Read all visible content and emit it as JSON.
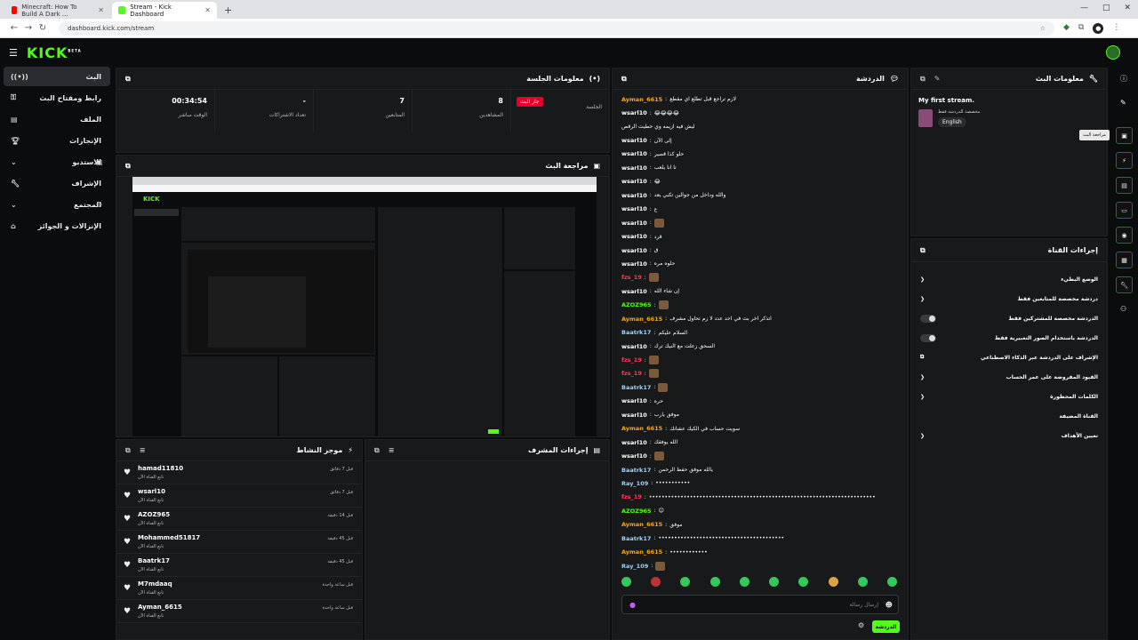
{
  "browser": {
    "tabs": [
      {
        "title": "Minecraft: How To Build A Dark ...",
        "active": false
      },
      {
        "title": "Stream - Kick Dashboard",
        "active": true
      }
    ],
    "url": "dashboard.kick.com/stream"
  },
  "brand": {
    "logo": "KICK",
    "beta": "BETA",
    "accent": "#53fc18"
  },
  "sidebar": {
    "items": [
      {
        "label": "البث",
        "icon": "live-icon",
        "active": true
      },
      {
        "label": "رابط ومفتاح البث",
        "icon": "key-icon"
      },
      {
        "label": "الملف",
        "icon": "file-icon"
      },
      {
        "label": "الإنجازات",
        "icon": "trophy-icon"
      },
      {
        "label": "الاستديو",
        "icon": "chevron-down-icon"
      },
      {
        "label": "الإشراف",
        "icon": "wrench-icon"
      },
      {
        "label": "المجتمع",
        "icon": "chevron-down-icon"
      },
      {
        "label": "الإنزالات و الجوائز",
        "icon": "gift-icon"
      }
    ]
  },
  "session": {
    "title": "معلومات الجلسة",
    "live_badge": "جار البث",
    "stats": [
      {
        "value": "00:34:54",
        "label": "الوقت مباشر"
      },
      {
        "value": "-",
        "label": "تعداد الاشتراكات"
      },
      {
        "value": "7",
        "label": "المتابعين"
      },
      {
        "value": "8",
        "label": "المشاهدين"
      },
      {
        "value": "",
        "label": "الجلسة"
      }
    ]
  },
  "preview": {
    "title": "مراجعة البث"
  },
  "activity": {
    "title": "موجز النشاط",
    "items": [
      {
        "name": "hamad11810",
        "sub": "تابع القناة الآن",
        "time": "قبل 7 دقائق"
      },
      {
        "name": "wsarl10",
        "sub": "تابع القناة الآن",
        "time": "قبل 7 دقائق"
      },
      {
        "name": "AZOZ965",
        "sub": "تابع القناة الآن",
        "time": "قبل 14 دقيقة"
      },
      {
        "name": "Mohammed51817",
        "sub": "تابع القناة الآن",
        "time": "قبل 45 دقيقة"
      },
      {
        "name": "Baatrk17",
        "sub": "تابع القناة الآن",
        "time": "قبل 45 دقيقة"
      },
      {
        "name": "M7mdaaq",
        "sub": "تابع القناة الآن",
        "time": "قبل ساعة واحدة"
      },
      {
        "name": "Ayman_6615",
        "sub": "تابع القناة الآن",
        "time": "قبل ساعة واحدة"
      }
    ]
  },
  "mod_actions": {
    "title": "إجراءات المشرف"
  },
  "chat": {
    "title": "الدردشة",
    "input_placeholder": "إرسال رسالة",
    "send_label": "الدردشة",
    "messages": [
      {
        "user": "Ayman_6615",
        "color": "#f5a623",
        "text": "لازم تراجع قبل تطلع اي مقطع"
      },
      {
        "user": "wsarl10",
        "color": "#ffffff",
        "text": "😂😂😂😂"
      },
      {
        "user": "",
        "color": "#ffffff",
        "text": "ليش فيه ازيمه وي حطيت الرقص"
      },
      {
        "user": "wsarl10",
        "color": "#ffffff",
        "text": "إلى الآن"
      },
      {
        "user": "wsarl10",
        "color": "#ffffff",
        "text": "حلو كذا قصير"
      },
      {
        "user": "wsarl10",
        "color": "#ffffff",
        "text": "تا انا يلعب"
      },
      {
        "user": "wsarl10",
        "color": "#ffffff",
        "text": "😂"
      },
      {
        "user": "wsarl10",
        "color": "#ffffff",
        "text": "والله وداخل من حوالين تكبي يعد"
      },
      {
        "user": "wsarl10",
        "color": "#ffffff",
        "text": "ع"
      },
      {
        "user": "wsarl10",
        "color": "#ffffff",
        "text": "[emote]"
      },
      {
        "user": "wsarl10",
        "color": "#ffffff",
        "text": "قرد"
      },
      {
        "user": "wsarl10",
        "color": "#ffffff",
        "text": "ق"
      },
      {
        "user": "wsarl10",
        "color": "#ffffff",
        "text": "حلوه مره"
      },
      {
        "user": "fzs_19",
        "color": "#ff3b5c",
        "text": "[emote]"
      },
      {
        "user": "wsarl10",
        "color": "#ffffff",
        "text": "إن شاء الله"
      },
      {
        "user": "AZOZ965",
        "color": "#53fc18",
        "text": "[emote]"
      },
      {
        "user": "Ayman_6615",
        "color": "#f5a623",
        "text": "اتذكر اخر بث في احد عدد لا زم تحاول مشرف"
      },
      {
        "user": "Baatrk17",
        "color": "#9fd3ff",
        "text": "السلام عليكم"
      },
      {
        "user": "wsarl10",
        "color": "#ffffff",
        "text": "السحق زعلت مع النيك ترك"
      },
      {
        "user": "fzs_19",
        "color": "#ff3b5c",
        "text": "[emote]"
      },
      {
        "user": "fzs_19",
        "color": "#ff3b5c",
        "text": "[emote]"
      },
      {
        "user": "Baatrk17",
        "color": "#9fd3ff",
        "text": "[emote]"
      },
      {
        "user": "wsarl10",
        "color": "#ffffff",
        "text": "حره"
      },
      {
        "user": "wsarl10",
        "color": "#ffffff",
        "text": "موفق يارب"
      },
      {
        "user": "Ayman_6615",
        "color": "#f5a623",
        "text": "سويت حساب في الكيك عشانك"
      },
      {
        "user": "wsarl10",
        "color": "#ffffff",
        "text": "الله يوفقك"
      },
      {
        "user": "wsarl10",
        "color": "#ffffff",
        "text": "[emote]"
      },
      {
        "user": "Baatrk17",
        "color": "#9fd3ff",
        "text": "يالله موفق حفظ الرحمن"
      },
      {
        "user": "Ray_109",
        "color": "#9fd3ff",
        "text": "•••••••••••"
      },
      {
        "user": "fzs_19",
        "color": "#ff3b5c",
        "text": "••••••••••••••••••••••••••••••••••••••••••••••••••••••••••••••••••••••••"
      },
      {
        "user": "AZOZ965",
        "color": "#53fc18",
        "text": "😊"
      },
      {
        "user": "Ayman_6615",
        "color": "#f5a623",
        "text": "موفق"
      },
      {
        "user": "Baatrk17",
        "color": "#9fd3ff",
        "text": "••••••••••••••••••••••••••••••••••••••••"
      },
      {
        "user": "Ayman_6615",
        "color": "#f5a623",
        "text": "••••••••••••"
      },
      {
        "user": "Ray_109",
        "color": "#9fd3ff",
        "text": "[emote]"
      }
    ]
  },
  "stream_info": {
    "title": "معلومات البث",
    "stream_title": "My first stream.",
    "category": "مخصصة للدردشة فقط",
    "language": "English"
  },
  "channel_actions": {
    "title": "إجراءات القناة",
    "rows": [
      {
        "label": "الوضع البطيء",
        "control": "chevron"
      },
      {
        "label": "دردشة مخصصة للمتابعين فقط",
        "control": "chevron"
      },
      {
        "label": "الدردشة مخصصة للمشتركين فقط",
        "control": "toggle"
      },
      {
        "label": "الدردشة باستخدام الصور التعبيرية فقط",
        "control": "toggle"
      },
      {
        "label": "الإشراف على الدردشة عبر الذكاء الاصطناعي",
        "control": "external"
      },
      {
        "label": "القيود المفروضة على عمر الحساب",
        "control": "chevron"
      },
      {
        "label": "الكلمات المحظورة",
        "control": "chevron"
      },
      {
        "label": "القناة المضيفة",
        "control": "none"
      },
      {
        "label": "تعيين الأهداف",
        "control": "chevron"
      }
    ]
  },
  "rail": {
    "tooltip": "مراجعة البث"
  }
}
